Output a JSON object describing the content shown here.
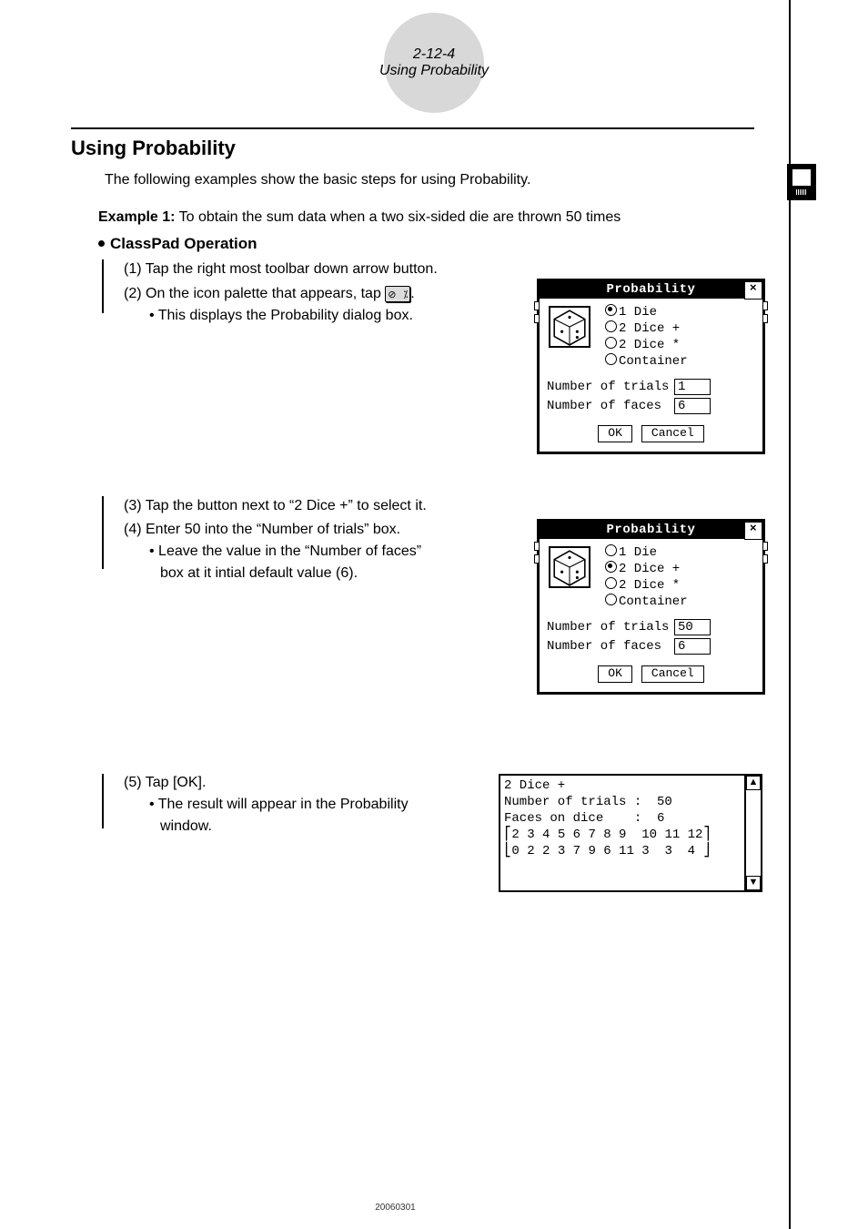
{
  "header": {
    "num": "2-12-4",
    "txt": "Using Probability"
  },
  "title": "Using Probability",
  "intro": "The following examples show the basic steps for using Probability.",
  "example": {
    "label": "Example 1:",
    "text": " To obtain the sum data when a two six-sided die are thrown 50 times"
  },
  "opHeader": "ClassPad Operation",
  "steps": {
    "s1": "(1) Tap the right most toolbar down arrow button.",
    "s2a": "(2) On the icon palette that appears, tap ",
    "s2b": ".",
    "s2note": "• This displays the Probability dialog box.",
    "s3": "(3) Tap the button next to “2 Dice +” to select it.",
    "s4": "(4) Enter 50 into the “Number of trials” box.",
    "s4noteA": "• Leave the value in the “Number of faces”",
    "s4noteB": "box at it intial default value (6).",
    "s5": "(5) Tap [OK].",
    "s5noteA": "• The result will appear in the Probability",
    "s5noteB": "window."
  },
  "dialog": {
    "title": "Probability",
    "opts": {
      "o1": "1 Die",
      "o2": "2 Dice +",
      "o3": "2 Dice *",
      "o4": "Container"
    },
    "trialsLabel": "Number of trials",
    "facesLabel": "Number of faces",
    "ok": "OK",
    "cancel": "Cancel",
    "d1": {
      "trials": "1",
      "faces": "6"
    },
    "d2": {
      "trials": "50",
      "faces": "6"
    }
  },
  "result": {
    "l1": "2 Dice +",
    "l2": "Number of trials :  50",
    "l3": "Faces on dice    :  6",
    "l4": "⎡2 3 4 5 6 7 8 9  10 11 12⎤",
    "l5": "⎣0 2 2 3 7 9 6 11 3  3  4 ⎦"
  },
  "footer": "20060301"
}
